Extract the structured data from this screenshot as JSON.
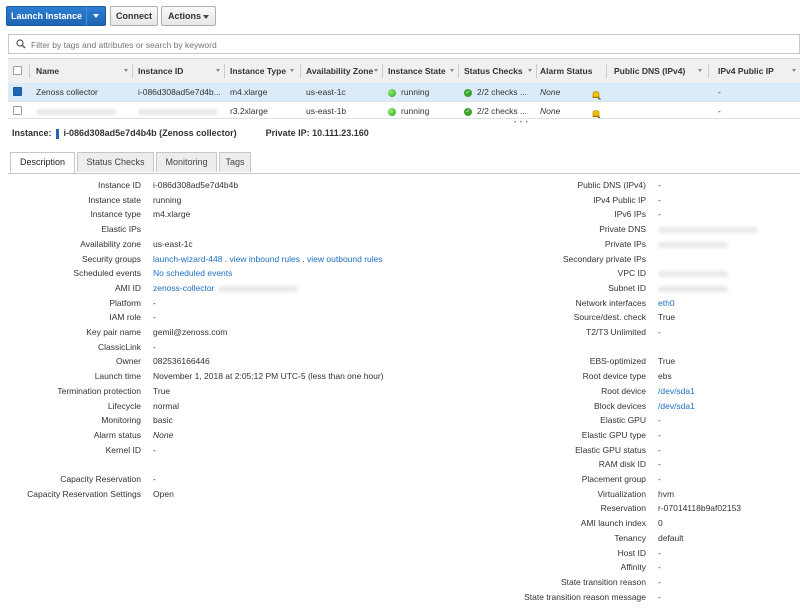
{
  "toolbar": {
    "launch_label": "Launch Instance",
    "connect_label": "Connect",
    "actions_label": "Actions"
  },
  "search": {
    "placeholder": "Filter by tags and attributes or search by keyword"
  },
  "table": {
    "columns": [
      "Name",
      "Instance ID",
      "Instance Type",
      "Availability Zone",
      "Instance State",
      "Status Checks",
      "Alarm Status",
      "Public DNS (IPv4)",
      "IPv4 Public IP"
    ],
    "rows": [
      {
        "name": "Zenoss collector",
        "instance_id": "i-086d308ad5e7d4b...",
        "type": "m4.xlarge",
        "zone": "us-east-1c",
        "state": "running",
        "checks": "2/2 checks ...",
        "alarm": "None",
        "dns": "",
        "ip": "-"
      },
      {
        "name": "",
        "instance_id": "",
        "type": "r3.2xlarge",
        "zone": "us-east-1b",
        "state": "running",
        "checks": "2/2 checks ...",
        "alarm": "None",
        "dns": "",
        "ip": "-"
      }
    ]
  },
  "instance_header": {
    "prefix": "Instance:",
    "id_label": "i-086d308ad5e7d4b4b (Zenoss collector)",
    "private_ip": "Private IP: 10.111.23.160"
  },
  "tabs": [
    "Description",
    "Status Checks",
    "Monitoring",
    "Tags"
  ],
  "left_details": [
    {
      "label": "Instance ID",
      "value": "i-086d308ad5e7d4b4b"
    },
    {
      "label": "Instance state",
      "value": "running"
    },
    {
      "label": "Instance type",
      "value": "m4.xlarge"
    },
    {
      "label": "Elastic IPs",
      "value": ""
    },
    {
      "label": "Availability zone",
      "value": "us-east-1c"
    },
    {
      "label": "Security groups",
      "value": "launch-wizard-448 . view inbound rules . view outbound rules"
    },
    {
      "label": "Scheduled events",
      "value": "No scheduled events"
    },
    {
      "label": "AMI ID",
      "value": "zenoss-collector"
    },
    {
      "label": "Platform",
      "value": "-"
    },
    {
      "label": "IAM role",
      "value": "-"
    },
    {
      "label": "Key pair name",
      "value": "gemil@zenoss.com"
    },
    {
      "label": "ClassicLink",
      "value": "-"
    },
    {
      "label": "Owner",
      "value": "082536166446"
    },
    {
      "label": "Launch time",
      "value": "November 1, 2018 at 2:05:12 PM UTC-5 (less than one hour)"
    },
    {
      "label": "Termination protection",
      "value": "True"
    },
    {
      "label": "Lifecycle",
      "value": "normal"
    },
    {
      "label": "Monitoring",
      "value": "basic"
    },
    {
      "label": "Alarm status",
      "value": "None"
    },
    {
      "label": "Kernel ID",
      "value": "-"
    },
    {
      "label": "",
      "value": ""
    },
    {
      "label": "Capacity Reservation",
      "value": "-"
    },
    {
      "label": "Capacity Reservation Settings",
      "value": "Open"
    }
  ],
  "right_details": [
    {
      "label": "Public DNS (IPv4)",
      "value": "-"
    },
    {
      "label": "IPv4 Public IP",
      "value": "-"
    },
    {
      "label": "IPv6 IPs",
      "value": "-"
    },
    {
      "label": "Private DNS",
      "value": ""
    },
    {
      "label": "Private IPs",
      "value": ""
    },
    {
      "label": "Secondary private IPs",
      "value": ""
    },
    {
      "label": "VPC ID",
      "value": ""
    },
    {
      "label": "Subnet ID",
      "value": ""
    },
    {
      "label": "Network interfaces",
      "value": "eth0"
    },
    {
      "label": "Source/dest. check",
      "value": "True"
    },
    {
      "label": "T2/T3 Unlimited",
      "value": "-"
    },
    {
      "label": "",
      "value": ""
    },
    {
      "label": "EBS-optimized",
      "value": "True"
    },
    {
      "label": "Root device type",
      "value": "ebs"
    },
    {
      "label": "Root device",
      "value": "/dev/sda1"
    },
    {
      "label": "Block devices",
      "value": "/dev/sda1"
    },
    {
      "label": "Elastic GPU",
      "value": "-"
    },
    {
      "label": "Elastic GPU type",
      "value": "-"
    },
    {
      "label": "Elastic GPU status",
      "value": "-"
    },
    {
      "label": "RAM disk ID",
      "value": "-"
    },
    {
      "label": "Placement group",
      "value": "-"
    },
    {
      "label": "Virtualization",
      "value": "hvm"
    },
    {
      "label": "Reservation",
      "value": "r-07014118b9af02153"
    },
    {
      "label": "AMI launch index",
      "value": "0"
    },
    {
      "label": "Tenancy",
      "value": "default"
    },
    {
      "label": "Host ID",
      "value": "-"
    },
    {
      "label": "Affinity",
      "value": "-"
    },
    {
      "label": "State transition reason",
      "value": "-"
    },
    {
      "label": "State transition reason message",
      "value": "-"
    }
  ]
}
